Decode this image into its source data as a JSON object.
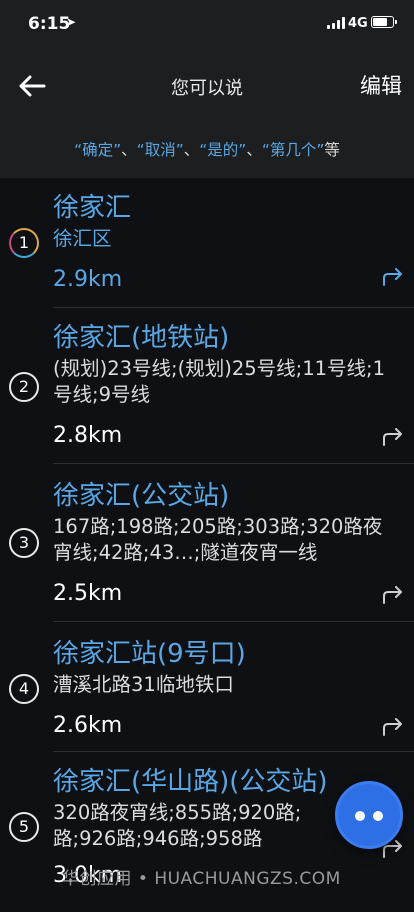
{
  "status": {
    "time": "6:15",
    "network": "4G"
  },
  "nav": {
    "title": "您可以说",
    "edit_label": "编辑"
  },
  "hint": {
    "q1": "“确定”",
    "sep1": "、",
    "q2": "“取消”",
    "sep2": "、",
    "q3": "“是的”",
    "sep3": "、",
    "q4": "“第几个”",
    "suffix": "等"
  },
  "items": [
    {
      "index": "1",
      "title": "徐家汇",
      "subtitle": "徐汇区",
      "distance": "2.9km"
    },
    {
      "index": "2",
      "title": "徐家汇(地铁站)",
      "subtitle": "(规划)23号线;(规划)25号线;11号线;1号线;9号线",
      "distance": "2.8km"
    },
    {
      "index": "3",
      "title": "徐家汇(公交站)",
      "subtitle": "167路;198路;205路;303路;320路夜宵线;42路;43…;隧道夜宵一线",
      "distance": "2.5km"
    },
    {
      "index": "4",
      "title": "徐家汇站(9号口)",
      "subtitle": "漕溪北路31临地铁口",
      "distance": "2.6km"
    },
    {
      "index": "5",
      "title": "徐家汇(华山路)(公交站)",
      "subtitle": "320路夜宵线;855路;920路;路;926路;946路;958路",
      "distance": "3.0km"
    }
  ],
  "watermark": "华创应用 • HUACHUANGZS.COM",
  "colors": {
    "accent": "#5aa7e6",
    "background": "#0e1013",
    "header": "#1d1e20",
    "fab": "#2f6fe6"
  }
}
